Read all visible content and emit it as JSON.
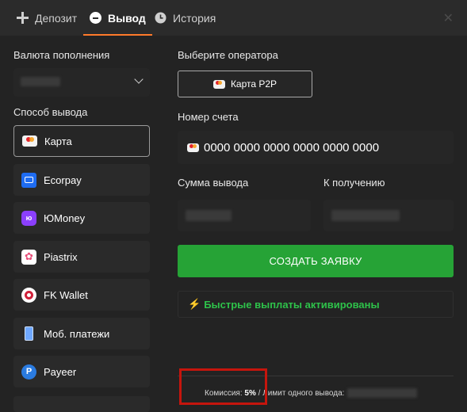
{
  "tabs": [
    {
      "label": "Депозит",
      "icon": "plus-icon",
      "active": false
    },
    {
      "label": "Вывод",
      "icon": "minus-circle-icon",
      "active": true
    },
    {
      "label": "История",
      "icon": "clock-icon",
      "active": false
    }
  ],
  "close_icon": "close-icon",
  "left": {
    "currency_label": "Валюта пополнения",
    "method_label": "Способ вывода",
    "methods": [
      {
        "label": "Карта",
        "icon": "visa-card-icon",
        "selected": true
      },
      {
        "label": "Ecorpay",
        "icon": "ecorpay-icon",
        "selected": false
      },
      {
        "label": "ЮMoney",
        "icon": "yoomoney-icon",
        "selected": false
      },
      {
        "label": "Piastrix",
        "icon": "piastrix-icon",
        "selected": false
      },
      {
        "label": "FK Wallet",
        "icon": "fkwallet-icon",
        "selected": false
      },
      {
        "label": "Моб. платежи",
        "icon": "mobile-phone-icon",
        "selected": false
      },
      {
        "label": "Payeer",
        "icon": "payeer-icon",
        "selected": false
      }
    ]
  },
  "right": {
    "operator_label": "Выберите оператора",
    "operator_button": "Карта P2P",
    "account_label": "Номер счета",
    "account_value": "0000 0000 0000 0000 0000 0000",
    "amount_label": "Сумма вывода",
    "receive_label": "К получению",
    "submit_label": "СОЗДАТЬ ЗАЯВКУ",
    "fast_payouts": "Быстрые выплаты активированы",
    "commission_label": "Комиссия:",
    "commission_value": "5%",
    "limit_label": "/ Лимит одного вывода:"
  },
  "colors": {
    "accent": "#ff7a2b",
    "submit": "#26a336",
    "fast_payouts": "#2ec24a",
    "highlight": "#c5150d"
  }
}
